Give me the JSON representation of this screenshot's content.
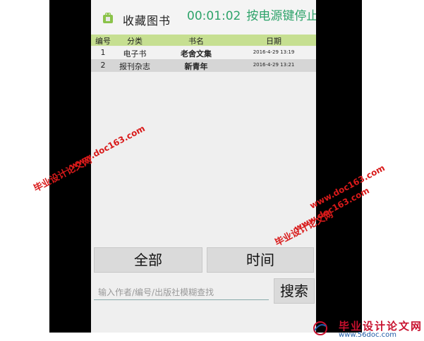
{
  "app": {
    "title": "收藏图书",
    "timer": "00:01:02",
    "timer_hint": "按电源键停止"
  },
  "table": {
    "headers": [
      "编号",
      "分类",
      "书名",
      "日期"
    ],
    "rows": [
      {
        "num": "1",
        "category": "电子书",
        "name": "老舍文集",
        "date": "2016-4-29 13:19"
      },
      {
        "num": "2",
        "category": "报刊杂志",
        "name": "新青年",
        "date": "2016-4-29 13:21"
      }
    ]
  },
  "buttons": {
    "all": "全部",
    "time": "时间",
    "search": "搜索"
  },
  "search": {
    "placeholder": "输入作者/编号/出版社模糊查找"
  },
  "watermarks": {
    "site_cn": "毕业设计论文网",
    "site_url": "www.doc163.com",
    "footer_title": "毕业设计论文网",
    "footer_url": "www.56doc.com"
  },
  "colors": {
    "header_green": "#c6df91",
    "timer_green": "#2ea36a",
    "watermark_red": "#d91a1a"
  }
}
